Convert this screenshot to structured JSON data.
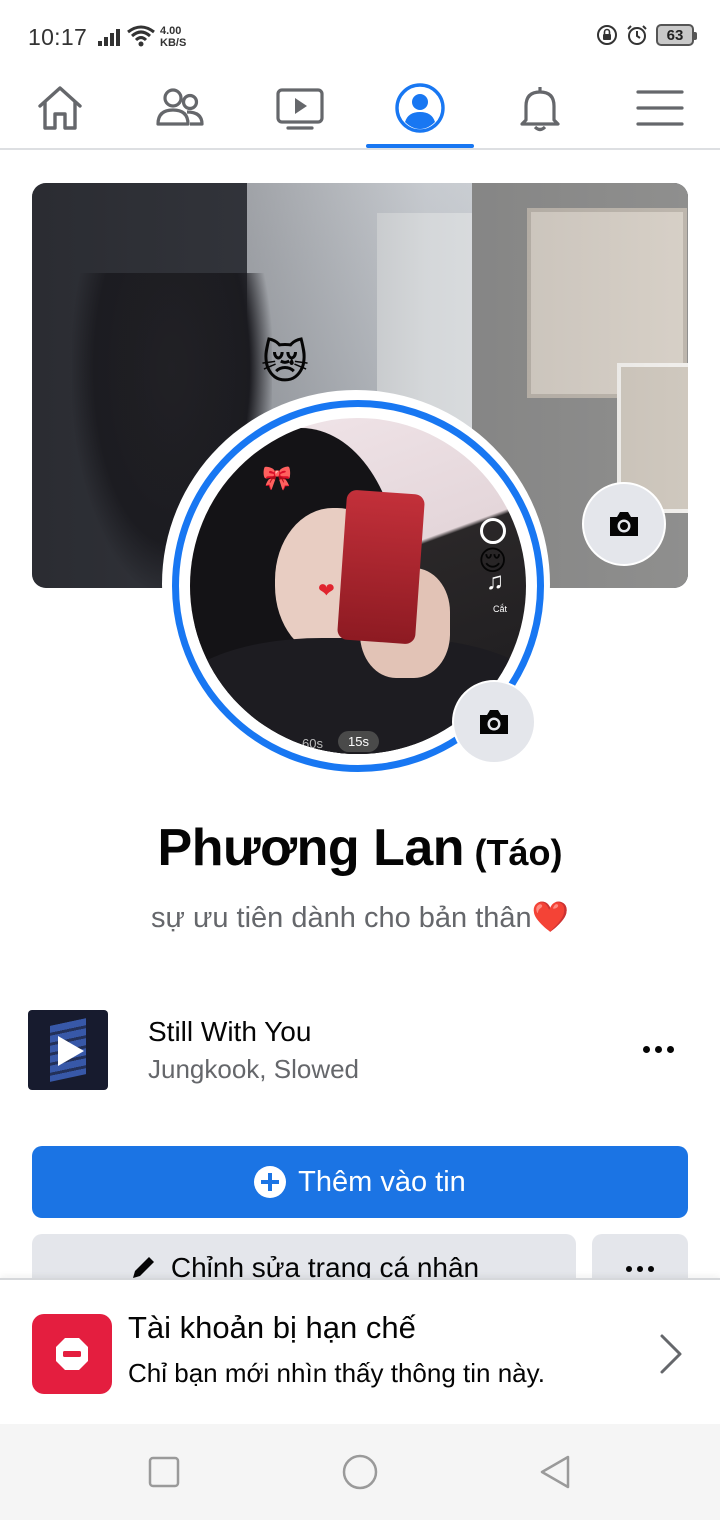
{
  "status_bar": {
    "time": "10:17",
    "net_speed_value": "4.00",
    "net_speed_unit": "KB/S",
    "battery": "63",
    "icons": [
      "signal-icon",
      "wifi-icon",
      "rotation-lock-icon",
      "alarm-icon",
      "battery-icon"
    ]
  },
  "top_nav": {
    "items": [
      "home-icon",
      "friends-icon",
      "watch-icon",
      "profile-icon",
      "notifications-icon",
      "menu-icon"
    ],
    "active": "profile-icon",
    "accent": "#1877f2"
  },
  "profile": {
    "name": "Phương Lan",
    "alternate_name": "(Táo)",
    "bio": "sự ưu tiên dành cho bản thân",
    "bio_emoji": "❤️",
    "cover_emoji": "😿",
    "avatar_overlay": {
      "seg_60": "60s",
      "seg_15": "15s",
      "cut_label": "Cắt"
    }
  },
  "music": {
    "title": "Still With You",
    "artist": "Jungkook, Slowed"
  },
  "actions": {
    "add_story_label": "Thêm vào tin",
    "edit_profile_label": "Chỉnh sửa trang cá nhân",
    "primary_color": "#1b74e4",
    "secondary_color": "#e4e6eb"
  },
  "restriction": {
    "title": "Tài khoản bị hạn chế",
    "message": "Chỉ bạn mới nhìn thấy thông tin này.",
    "color": "#e41e3f"
  },
  "android_nav": [
    "recents-square-icon",
    "home-circle-icon",
    "back-triangle-icon"
  ]
}
